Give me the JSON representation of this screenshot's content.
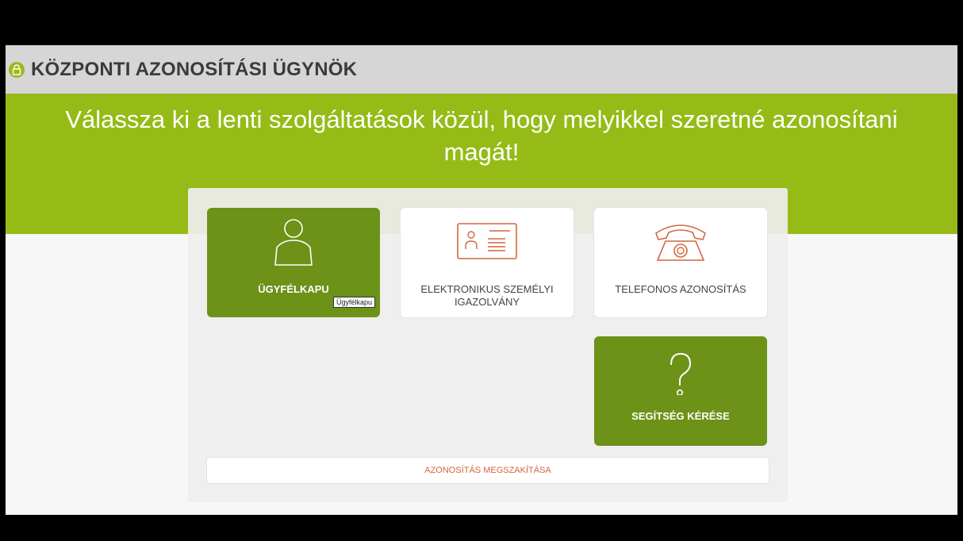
{
  "header": {
    "title": "KÖZPONTI AZONOSÍTÁSI ÜGYNÖK"
  },
  "hero": {
    "text": "Válassza ki a lenti szolgáltatások közül, hogy melyikkel szeretné azonosítani magát!"
  },
  "tiles": [
    {
      "label": "ÜGYFÉLKAPU",
      "icon": "user-icon",
      "tooltip": "Ügyfélkapu"
    },
    {
      "label_line1": "ELEKTRONIKUS SZEMÉLYI",
      "label_line2": "IGAZOLVÁNY",
      "icon": "id-card-icon"
    },
    {
      "label": "TELEFONOS AZONOSÍTÁS",
      "icon": "telephone-icon"
    },
    {
      "label": "SEGÍTSÉG KÉRÉSE",
      "icon": "question-mark-icon"
    }
  ],
  "cancel": {
    "label": "AZONOSÍTÁS MEGSZAKÍTÁSA"
  },
  "colors": {
    "brand_green": "#96bb16",
    "tile_green": "#6c9217",
    "accent_orange": "#d2673e",
    "header_gray": "#d6d6d6"
  }
}
